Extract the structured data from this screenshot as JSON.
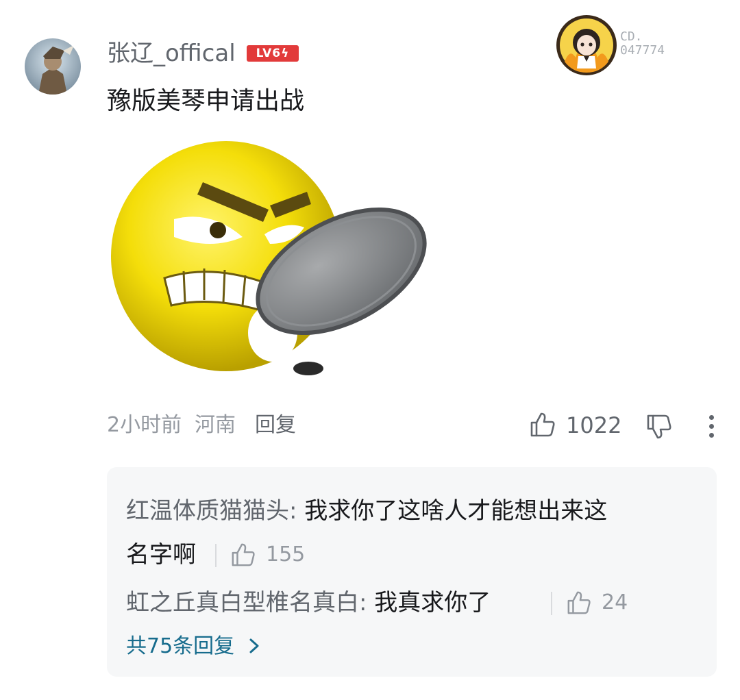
{
  "comment": {
    "username": "张辽_offical",
    "level_badge": "LV6",
    "fan_number_label": "CD.",
    "fan_number": "047774",
    "text": "豫版美琴申请出战",
    "time": "2小时前",
    "location": "河南",
    "reply_label": "回复",
    "like_count": "1022"
  },
  "replies": [
    {
      "name": "红温体质猫猫头",
      "separator": ":",
      "line1": " 我求你了这啥人才能想出来这",
      "line2": "名字啊",
      "like_count": "155"
    },
    {
      "name": "虹之丘真白型椎名真白",
      "separator": ":",
      "line1": " 我真求你了",
      "like_count": "24"
    }
  ],
  "view_all_label": "共75条回复",
  "icons": [
    "like-icon",
    "dislike-icon",
    "more-icon",
    "chevron-right-icon"
  ],
  "colors": {
    "username": "#61666d",
    "level_badge": "#e23a3a",
    "view_all": "#176c8d",
    "reply_box_bg": "#f6f7f8"
  }
}
